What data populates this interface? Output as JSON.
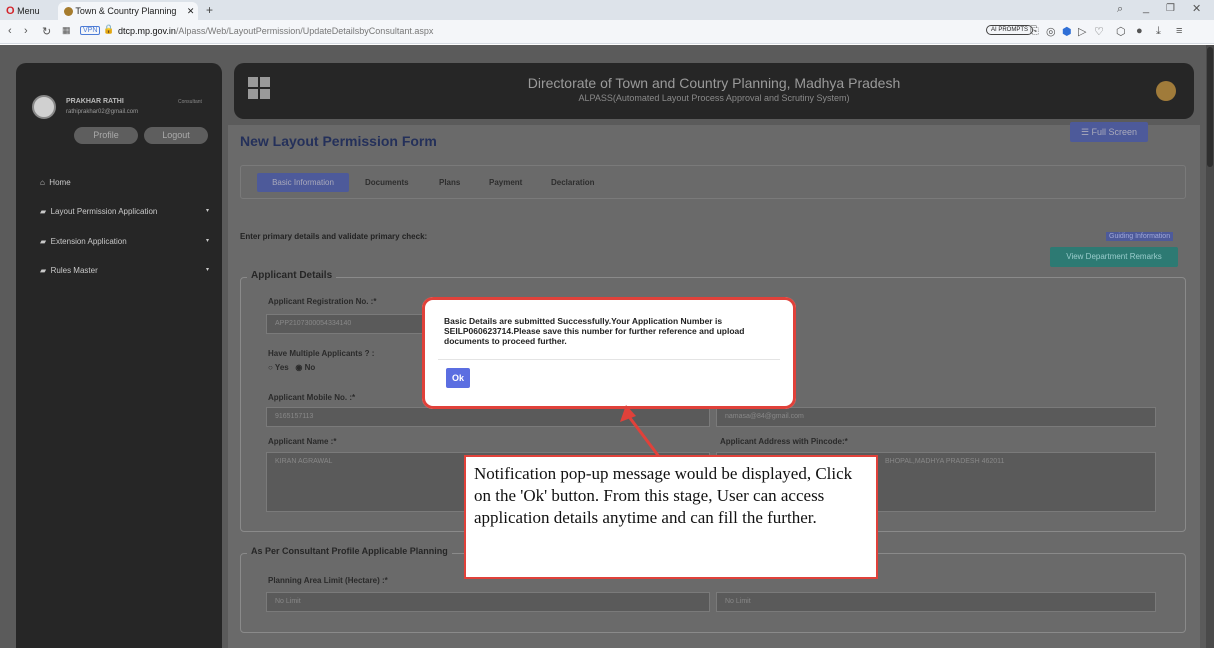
{
  "browser": {
    "menu_label": "Menu",
    "tab_title": "Town & Country Planning",
    "vpn": "VPN",
    "url_host": "dtcp.mp.gov.in",
    "url_path": "/Alpass/Web/LayoutPermission/UpdateDetailsbyConsultant.aspx",
    "ai_prompts": "AI PROMPTS"
  },
  "user": {
    "name": "PRAKHAR RATHI",
    "role": "Consultant",
    "email": "rathiprakhar02@gmail.com"
  },
  "sidebar": {
    "profile": "Profile",
    "logout": "Logout",
    "items": [
      {
        "label": "Home"
      },
      {
        "label": "Layout Permission Application"
      },
      {
        "label": "Extension Application"
      },
      {
        "label": "Rules Master"
      }
    ]
  },
  "header": {
    "title": "Directorate of Town and Country Planning, Madhya Pradesh",
    "subtitle": "ALPASS(Automated Layout Process Approval and Scrutiny System)"
  },
  "form": {
    "title": "New Layout Permission Form",
    "full_screen": "Full Screen",
    "tabs": [
      {
        "label": "Basic Information"
      },
      {
        "label": "Documents"
      },
      {
        "label": "Plans"
      },
      {
        "label": "Payment"
      },
      {
        "label": "Declaration"
      }
    ],
    "instruction": "Enter primary details and validate primary check:",
    "guiding": "Guiding Information",
    "view_remarks": "View Department Remarks",
    "applicant_section": "Applicant Details",
    "reg_label": "Applicant Registration No. :*",
    "reg_value": "APP2107300054334140",
    "multiple_label": "Have Multiple Applicants ? :",
    "yes": "Yes",
    "no": "No",
    "mobile_label": "Applicant Mobile No. :*",
    "mobile_value": "9165157113",
    "email_value": "namasa@84@gmail.com",
    "name_label": "Applicant Name :*",
    "name_value": "KIRAN AGRAWAL",
    "address_label": "Applicant Address with Pincode:*",
    "address_value": "BHOPAL,MADHYA PRADESH 462011",
    "consultant_section": "As Per Consultant Profile Applicable Planning",
    "area_label": "Planning Area Limit (Hectare) :*",
    "area_value": "No Limit",
    "area_value2": "No Limit"
  },
  "dialog": {
    "message": "Basic Details are submitted Successfully.Your Application Number is SEILP060623714.Please save this number for further reference and upload documents to proceed further.",
    "ok": "Ok"
  },
  "callout": {
    "text": "Notification pop-up message would be displayed, Click on the 'Ok' button. From this stage, User can access application details anytime and can fill the further."
  },
  "colors": {
    "accent": "#5b6ee1",
    "highlight": "#e0413a",
    "teal": "#2aa39a"
  }
}
